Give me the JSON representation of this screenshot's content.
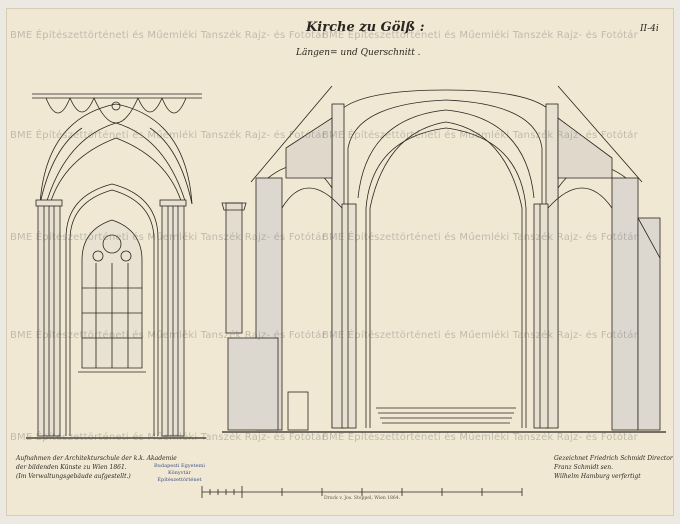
{
  "title": "Kirche zu Gölß :",
  "subtitle": "Längen= und Querschnitt .",
  "sheet_number": "II-4i",
  "watermark": "BME Építészettörténeti és Műemléki Tanszék Rajz- és Fotótár",
  "note_left": [
    "Aufnahmen der Architekturschule der k.k. Akademie",
    "der bildenden Künste zu Wien 1861.",
    "(Im Verwaltungsgebäude aufgestellt.)"
  ],
  "stamp_lines": [
    "Budapesti Egyetemi",
    "Könyvtár",
    "Építészettörténet"
  ],
  "note_right": [
    "Gezeichnet Friedrich Schmidt Director",
    "Franz Schmidt sen.",
    "Wilhelm Hamburg verfertigt"
  ],
  "printer_credit": "Druck v. Jos. Stoppel, Wien 1864.",
  "colors": {
    "paper": "#f1e8d3",
    "ink": "#2a2520",
    "wall": "#ddd8cf",
    "stamp": "#3a4f8c"
  }
}
